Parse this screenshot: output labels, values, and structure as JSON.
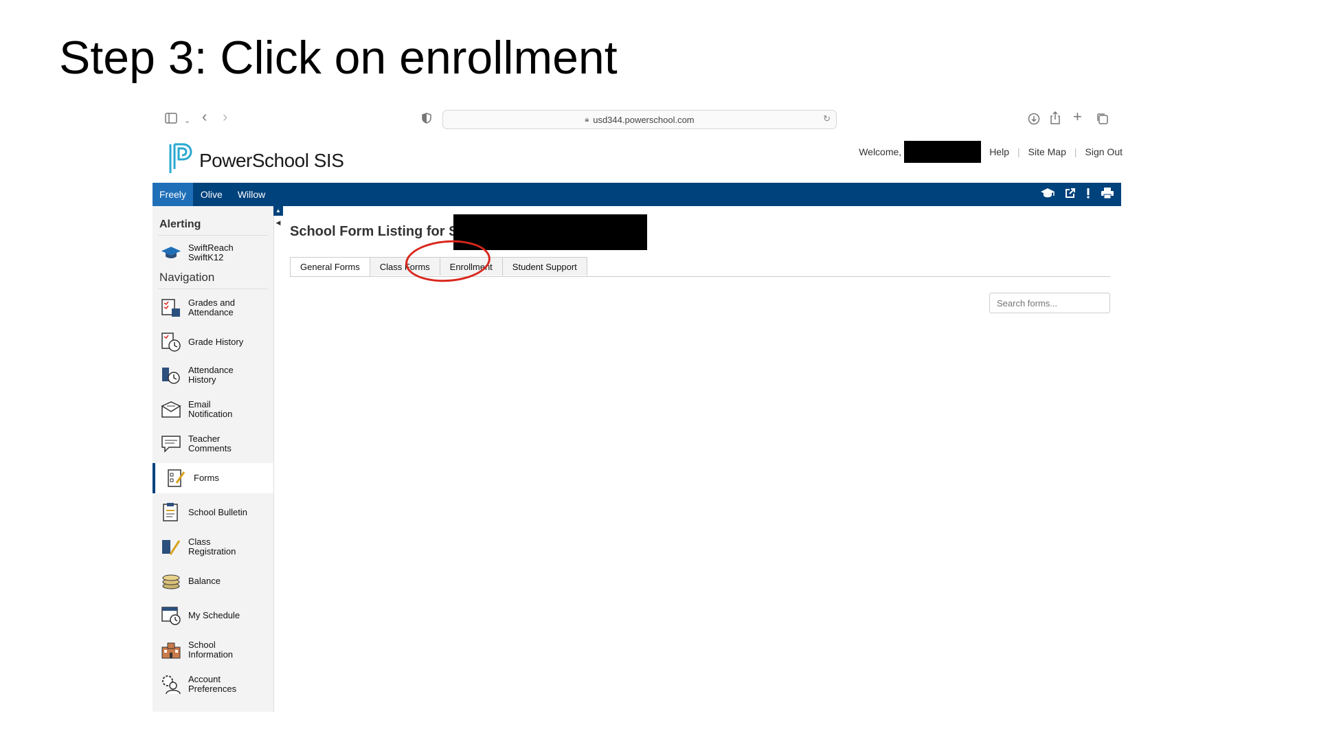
{
  "slide": {
    "title": "Step 3: Click on enrollment"
  },
  "browser": {
    "url": "usd344.powerschool.com",
    "icons": [
      "sidebar-icon",
      "chevron-down-icon",
      "back-icon",
      "forward-icon",
      "shield-icon",
      "download-icon",
      "share-icon",
      "plus-icon",
      "tabs-icon"
    ]
  },
  "header": {
    "logo_text": "PowerSchool SIS",
    "welcome": "Welcome,",
    "links": [
      "Help",
      "Site Map",
      "Sign Out"
    ]
  },
  "navbar": {
    "students": [
      "Freely",
      "Olive",
      "Willow"
    ],
    "active_student": "Freely",
    "icons": [
      "graduation-cap-icon",
      "external-link-icon",
      "alert-icon",
      "print-icon"
    ]
  },
  "sidebar": {
    "alerting_heading": "Alerting",
    "alerting_items": [
      {
        "label_1": "SwiftReach",
        "label_2": "SwiftK12"
      }
    ],
    "navigation_heading": "Navigation",
    "items": [
      {
        "label_1": "Grades and",
        "label_2": "Attendance"
      },
      {
        "label_1": "Grade History",
        "label_2": ""
      },
      {
        "label_1": "Attendance",
        "label_2": "History"
      },
      {
        "label_1": "Email",
        "label_2": "Notification"
      },
      {
        "label_1": "Teacher",
        "label_2": "Comments"
      },
      {
        "label_1": "Forms",
        "label_2": ""
      },
      {
        "label_1": "School Bulletin",
        "label_2": ""
      },
      {
        "label_1": "Class",
        "label_2": "Registration"
      },
      {
        "label_1": "Balance",
        "label_2": ""
      },
      {
        "label_1": "My Schedule",
        "label_2": ""
      },
      {
        "label_1": "School",
        "label_2": "Information"
      },
      {
        "label_1": "Account",
        "label_2": "Preferences"
      }
    ],
    "active_item": "Forms"
  },
  "main": {
    "heading": "School Form Listing for S",
    "tabs": [
      "General Forms",
      "Class Forms",
      "Enrollment",
      "Student Support"
    ],
    "active_tab": "General Forms",
    "search_placeholder": "Search forms..."
  },
  "colors": {
    "nav_blue": "#00427c",
    "active_tab_blue": "#1f6fb8",
    "annotation_red": "#d9261c"
  }
}
